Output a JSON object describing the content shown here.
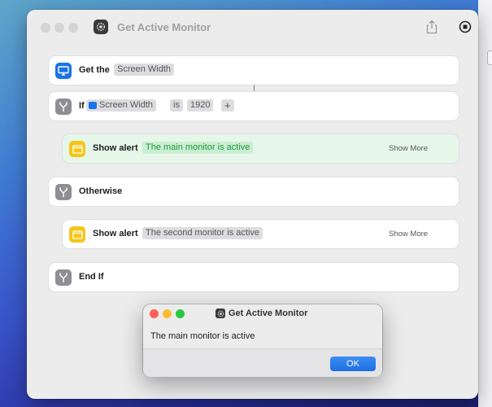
{
  "window": {
    "title": "Get Active Monitor"
  },
  "actions": [
    {
      "label": "Get the",
      "token": "Screen Width"
    },
    {
      "label": "If",
      "variable": "Screen Width",
      "operator": "is",
      "value": "1920",
      "add_symbol": "+"
    },
    {
      "label": "Show alert",
      "token": "The main monitor is active",
      "more": "Show More"
    },
    {
      "label": "Otherwise"
    },
    {
      "label": "Show alert",
      "token": "The second monitor is active",
      "more": "Show More"
    },
    {
      "label": "End If"
    }
  ],
  "dialog": {
    "title": "Get Active Monitor",
    "message": "The main monitor is active",
    "ok_label": "OK"
  },
  "colors": {
    "accent_blue": "#1a73e8",
    "alert_yellow": "#f5c518",
    "highlight_green": "#1e9a3c",
    "traffic_red": "#ff5f57",
    "traffic_yellow": "#febc2e",
    "traffic_green": "#28c840"
  }
}
